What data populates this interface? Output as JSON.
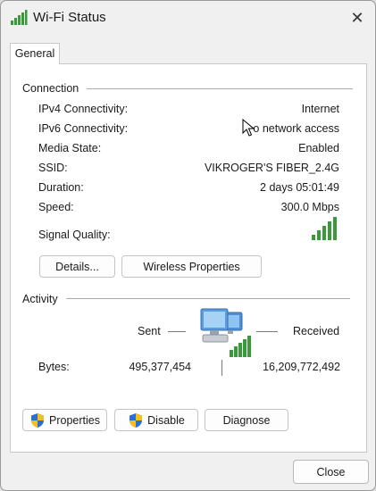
{
  "window": {
    "title": "Wi-Fi Status",
    "close_glyph": "✕"
  },
  "tabs": [
    {
      "label": "General"
    }
  ],
  "connection": {
    "heading": "Connection",
    "rows": [
      {
        "label": "IPv4 Connectivity:",
        "value": "Internet"
      },
      {
        "label": "IPv6 Connectivity:",
        "value": "o network access"
      },
      {
        "label": "Media State:",
        "value": "Enabled"
      },
      {
        "label": "SSID:",
        "value": "VIKROGER'S FIBER_2.4G"
      },
      {
        "label": "Duration:",
        "value": "2 days 05:01:49"
      },
      {
        "label": "Speed:",
        "value": "300.0 Mbps"
      },
      {
        "label": "Signal Quality:",
        "value": ""
      }
    ],
    "signal_bars_lit": 5,
    "signal_bars_total": 5,
    "details_button": "Details...",
    "wireless_button": "Wireless Properties"
  },
  "activity": {
    "heading": "Activity",
    "sent_label": "Sent",
    "received_label": "Received",
    "bytes_label": "Bytes:",
    "bytes_sent": "495,377,454",
    "bytes_received": "16,209,772,492",
    "properties_button": "Properties",
    "disable_button": "Disable",
    "diagnose_button": "Diagnose"
  },
  "footer": {
    "close_button": "Close"
  },
  "colors": {
    "signal_green": "#3a9a3a",
    "shield_blue": "#2a6fd6",
    "shield_yellow": "#f2c21b"
  },
  "icons": [
    "wifi-signal-icon",
    "close-icon",
    "network-computers-icon",
    "uac-shield-icon"
  ]
}
